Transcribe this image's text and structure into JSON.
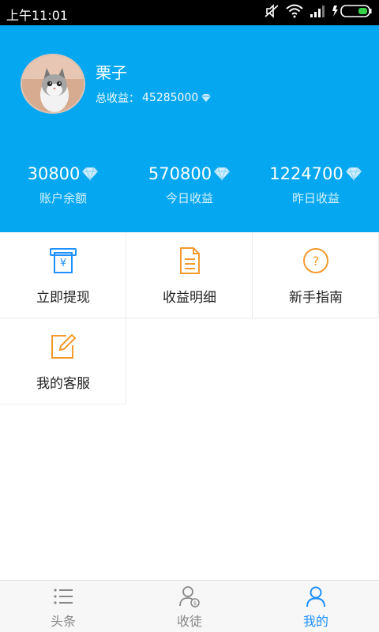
{
  "status_bar": {
    "time": "上午11:01"
  },
  "profile": {
    "name": "栗子",
    "total_label": "总收益：",
    "total_value": "45285000"
  },
  "stats": [
    {
      "value": "30800",
      "label": "账户余额"
    },
    {
      "value": "570800",
      "label": "今日收益"
    },
    {
      "value": "1224700",
      "label": "昨日收益"
    }
  ],
  "menu": [
    {
      "label": "立即提现",
      "icon": "atm-cash-icon"
    },
    {
      "label": "收益明细",
      "icon": "document-icon"
    },
    {
      "label": "新手指南",
      "icon": "help-circle-icon"
    },
    {
      "label": "我的客服",
      "icon": "edit-note-icon"
    }
  ],
  "nav": [
    {
      "label": "头条",
      "icon": "list-icon"
    },
    {
      "label": "收徒",
      "icon": "user-coin-icon"
    },
    {
      "label": "我的",
      "icon": "user-icon"
    }
  ],
  "colors": {
    "header": "#05a8f0",
    "accent_blue": "#1e90ff",
    "accent_orange": "#f39a2d",
    "diamond": "#cfeeff"
  }
}
